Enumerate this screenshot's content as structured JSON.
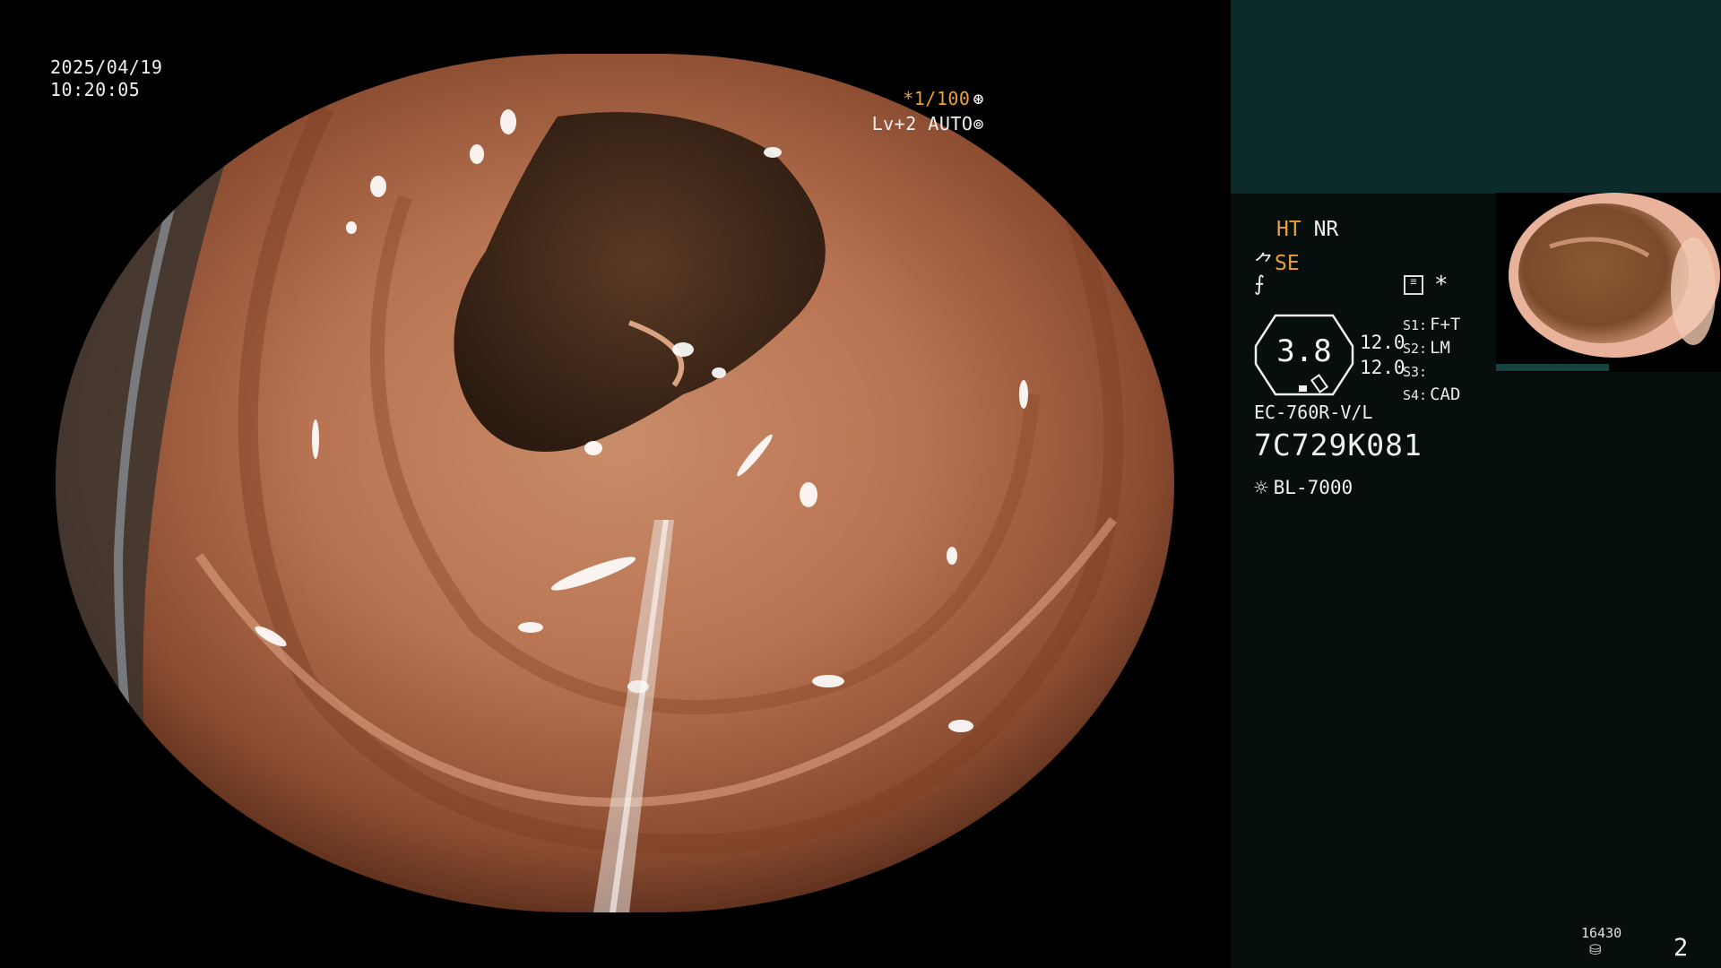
{
  "overlay": {
    "date": "2025/04/19",
    "time": "10:20:05",
    "shutter": "*1/100",
    "shutter_glyph": "⊛",
    "level": "Lv+2 AUTO",
    "level_glyph": "⊚"
  },
  "panel": {
    "ht": "HT",
    "nr": "NR",
    "se_icon": "⺈",
    "se": "SE",
    "f_icon": "⨍",
    "menu_icon": "settings-sliders-icon",
    "star": "*",
    "value": "3.8",
    "num1": "12.0",
    "num2": "12.0",
    "scopes": [
      {
        "key": "S1:",
        "value": "F+T"
      },
      {
        "key": "S2:",
        "value": "LM"
      },
      {
        "key": "S3:",
        "value": ""
      },
      {
        "key": "S4:",
        "value": "CAD"
      }
    ],
    "model": "EC-760R-V/L",
    "serial": "7C729K081",
    "light_icon": "☼",
    "light_source": "BL-7000",
    "footer_count": "16430",
    "footer_disk_icon": "⛁",
    "footer_page": "2"
  },
  "colors": {
    "accent_orange": "#e8a13a",
    "panel_dark": "#060e0e",
    "panel_top": "#0b2a2a"
  }
}
